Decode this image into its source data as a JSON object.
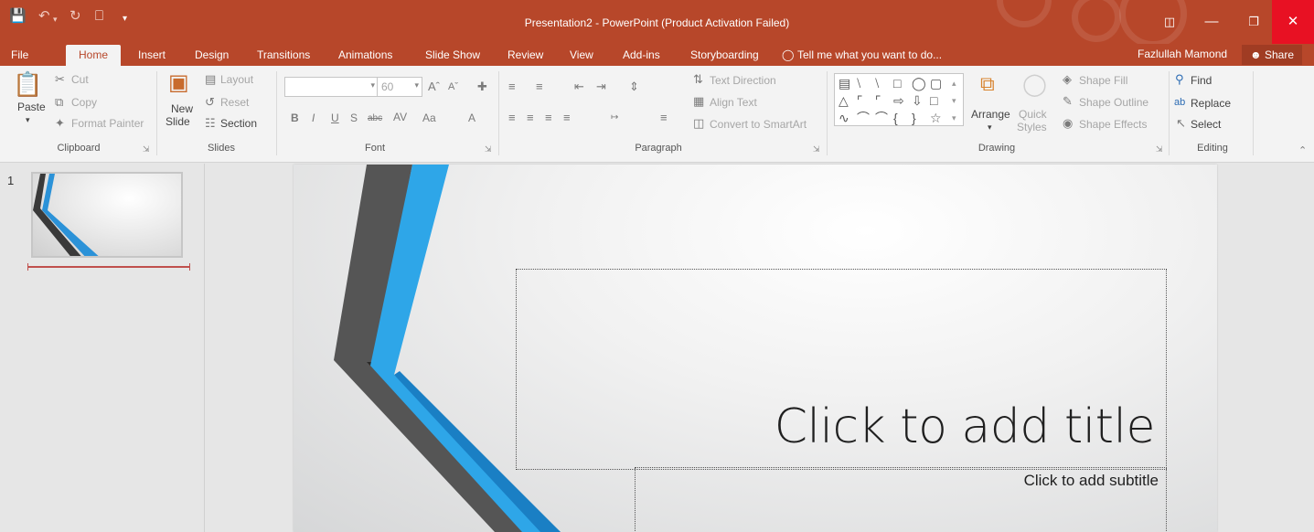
{
  "window": {
    "title": "Presentation2 - PowerPoint (Product Activation Failed)",
    "user": "Fazlullah Mamond",
    "share": "Share"
  },
  "tabs": [
    "File",
    "Home",
    "Insert",
    "Design",
    "Transitions",
    "Animations",
    "Slide Show",
    "Review",
    "View",
    "Add-ins",
    "Storyboarding"
  ],
  "tell_me": "Tell me what you want to do...",
  "ribbon": {
    "clipboard": {
      "paste": "Paste",
      "cut": "Cut",
      "copy": "Copy",
      "format_painter": "Format Painter",
      "label": "Clipboard"
    },
    "slides": {
      "new_slide_line1": "New",
      "new_slide_line2": "Slide",
      "layout": "Layout",
      "reset": "Reset",
      "section": "Section",
      "label": "Slides"
    },
    "font": {
      "font_name": "",
      "font_size": "60",
      "label": "Font"
    },
    "paragraph": {
      "text_direction": "Text Direction",
      "align_text": "Align Text",
      "convert_smartart": "Convert to SmartArt",
      "label": "Paragraph"
    },
    "drawing": {
      "arrange": "Arrange",
      "quick_styles_line1": "Quick",
      "quick_styles_line2": "Styles",
      "shape_fill": "Shape Fill",
      "shape_outline": "Shape Outline",
      "shape_effects": "Shape Effects",
      "label": "Drawing"
    },
    "editing": {
      "find": "Find",
      "replace": "Replace",
      "select": "Select",
      "label": "Editing"
    }
  },
  "thumbnails": [
    {
      "number": "1"
    }
  ],
  "slide": {
    "title_placeholder": "Click to add title",
    "subtitle_placeholder": "Click to add subtitle"
  },
  "colors": {
    "accent": "#b7472a",
    "slide_blue": "#2f9fe0",
    "slide_dark": "#3a3a3a"
  },
  "icons": [
    "save-icon",
    "undo-icon",
    "redo-icon",
    "slideshow-icon",
    "customize-icon",
    "ribbon-display-icon",
    "minimize-icon",
    "restore-icon",
    "close-icon",
    "lightbulb-icon",
    "user-icon",
    "paste-icon",
    "cut-icon",
    "copy-icon",
    "format-painter-icon",
    "find-icon",
    "replace-icon",
    "select-icon",
    "collapse-ribbon-icon"
  ]
}
